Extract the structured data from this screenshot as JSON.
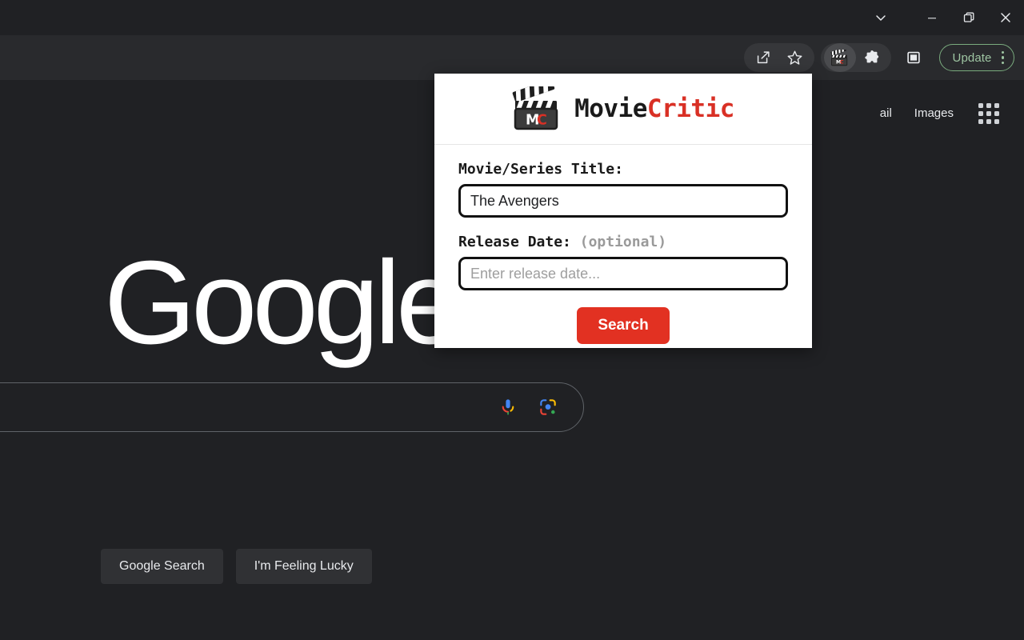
{
  "window": {
    "controls": [
      {
        "name": "tab-search",
        "icon": "chevron-down-icon",
        "label": "Search tabs"
      },
      {
        "name": "minimize",
        "icon": "minimize-icon",
        "label": "Minimize"
      },
      {
        "name": "maximize",
        "icon": "restore-icon",
        "label": "Restore"
      },
      {
        "name": "close",
        "icon": "close-icon",
        "label": "Close"
      }
    ]
  },
  "toolbar": {
    "share_label": "Share this page",
    "bookmark_label": "Bookmark this tab",
    "extension_label": "MovieCritic",
    "extensions_label": "Extensions",
    "sidepanel_label": "Side panel",
    "update_label": "Update",
    "menu_label": "Customize and control Google Chrome",
    "update_border_color": "#7aab7e",
    "update_text_color": "#9ec5a2"
  },
  "google": {
    "nav": [
      {
        "label": "ail"
      },
      {
        "label": "Images"
      }
    ],
    "apps_label": "Google apps",
    "logo_text": "Google",
    "logo_color": "#ffffff",
    "mic_label": "Search by voice",
    "lens_label": "Search by image",
    "search_placeholder": "",
    "search_value": "",
    "buttons": [
      {
        "label": "Google Search"
      },
      {
        "label": "I'm Feeling Lucky"
      }
    ],
    "background_color": "#202124"
  },
  "popup": {
    "brand_part1": "Movie",
    "brand_part2": "Critic",
    "logo_icon": "clapperboard-icon",
    "logo_initials": "MC",
    "fields": [
      {
        "label": "Movie/Series Title:",
        "optional_note": "",
        "value": "The Avengers",
        "placeholder": ""
      },
      {
        "label": "Release Date:",
        "optional_note": "(optional)",
        "value": "",
        "placeholder": "Enter release date..."
      }
    ],
    "submit_label": "Search",
    "accent_color": "#e23122",
    "background_color": "#ffffff"
  }
}
